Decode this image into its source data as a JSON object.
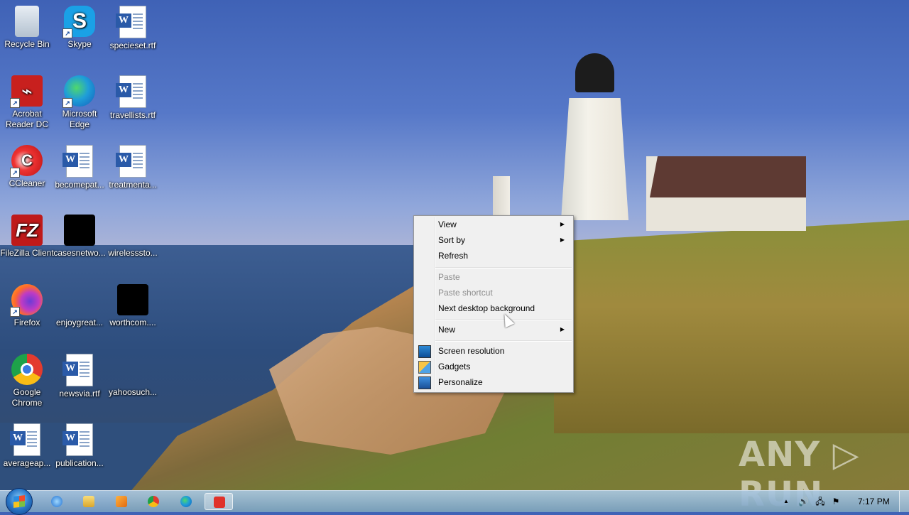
{
  "desktop": {
    "icons": [
      {
        "label": "Recycle Bin",
        "icon": "recycle-bin-icon"
      },
      {
        "label": "Skype",
        "icon": "skype-icon"
      },
      {
        "label": "specieset.rtf",
        "icon": "word-document-icon"
      },
      {
        "label": "Acrobat Reader DC",
        "icon": "acrobat-icon"
      },
      {
        "label": "Microsoft Edge",
        "icon": "edge-icon"
      },
      {
        "label": "travellists.rtf",
        "icon": "word-document-icon"
      },
      {
        "label": "CCleaner",
        "icon": "ccleaner-icon"
      },
      {
        "label": "becomepat...",
        "icon": "word-document-icon"
      },
      {
        "label": "treatmenta...",
        "icon": "word-document-icon"
      },
      {
        "label": "FileZilla Client",
        "icon": "filezilla-icon"
      },
      {
        "label": "casesnetwo...",
        "icon": "redacted-file-icon"
      },
      {
        "label": "wirelesssto...",
        "icon": "blank-file-icon"
      },
      {
        "label": "Firefox",
        "icon": "firefox-icon"
      },
      {
        "label": "enjoygreat...",
        "icon": "blank-file-icon"
      },
      {
        "label": "worthcom....",
        "icon": "redacted-file-icon"
      },
      {
        "label": "Google Chrome",
        "icon": "chrome-icon"
      },
      {
        "label": "newsvia.rtf",
        "icon": "word-document-icon"
      },
      {
        "label": "yahoosuch...",
        "icon": "blank-file-icon"
      },
      {
        "label": "averageap...",
        "icon": "word-document-icon"
      },
      {
        "label": "publication...",
        "icon": "word-document-icon"
      }
    ]
  },
  "context_menu": {
    "items": [
      {
        "label": "View",
        "submenu": true,
        "enabled": true
      },
      {
        "label": "Sort by",
        "submenu": true,
        "enabled": true
      },
      {
        "label": "Refresh",
        "submenu": false,
        "enabled": true
      },
      {
        "label": "Paste",
        "submenu": false,
        "enabled": false
      },
      {
        "label": "Paste shortcut",
        "submenu": false,
        "enabled": false
      },
      {
        "label": "Next desktop background",
        "submenu": false,
        "enabled": true
      },
      {
        "label": "New",
        "submenu": true,
        "enabled": true
      },
      {
        "label": "Screen resolution",
        "submenu": false,
        "enabled": true,
        "icon": "screen-resolution-icon"
      },
      {
        "label": "Gadgets",
        "submenu": false,
        "enabled": true,
        "icon": "gadgets-icon"
      },
      {
        "label": "Personalize",
        "submenu": false,
        "enabled": true,
        "icon": "personalize-icon"
      }
    ],
    "submenu_arrow": "▶"
  },
  "watermark": {
    "text": "ANY ▷ RUN"
  },
  "taskbar": {
    "pinned": [
      "internet-explorer-icon",
      "file-explorer-icon",
      "media-player-icon",
      "chrome-icon",
      "edge-icon",
      "anyrun-app-icon"
    ],
    "tray": {
      "show_hidden": "▲",
      "time": "7:17 PM"
    }
  },
  "colors": {
    "menu_bg": "#f0f0f0",
    "taskbar": "#8fb4d4",
    "text_shadow": "#000000"
  }
}
